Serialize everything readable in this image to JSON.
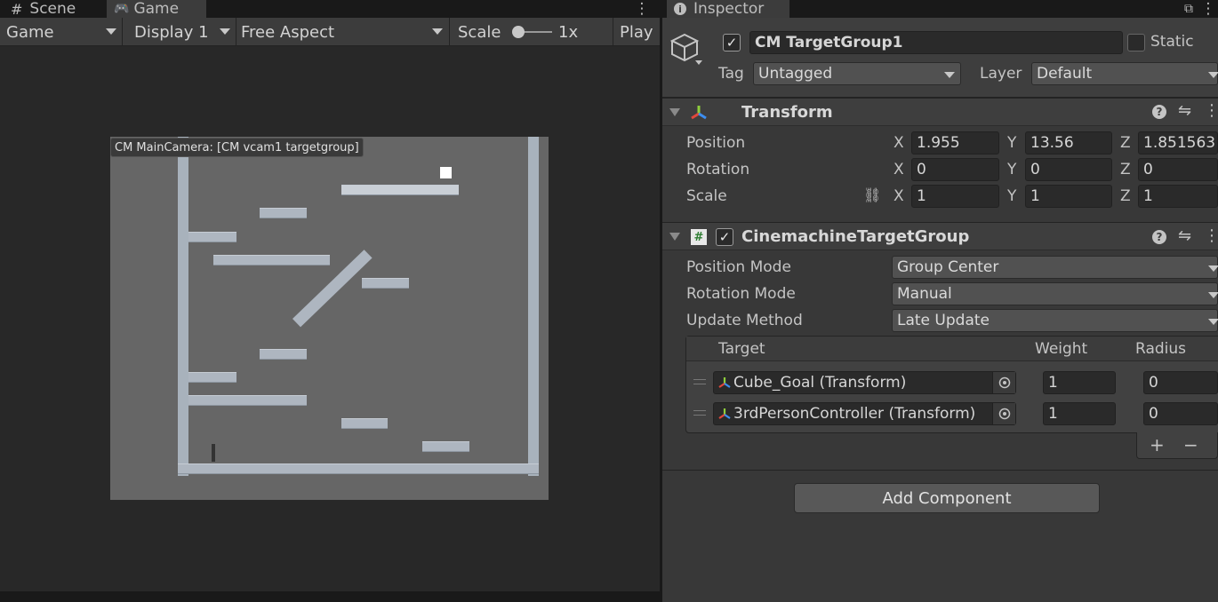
{
  "left_tabs": {
    "scene": "Scene",
    "game": "Game"
  },
  "game_toolbar": {
    "display_mode": "Game",
    "display": "Display 1",
    "aspect": "Free Aspect",
    "scale_label": "Scale",
    "scale_value": "1x",
    "play": "Play"
  },
  "game_view": {
    "camera_label": "CM MainCamera: [CM vcam1 targetgroup]"
  },
  "inspector": {
    "tab": "Inspector",
    "object_name": "CM TargetGroup1",
    "static_label": "Static",
    "tag_label": "Tag",
    "tag_value": "Untagged",
    "layer_label": "Layer",
    "layer_value": "Default",
    "transform": {
      "title": "Transform",
      "position_label": "Position",
      "rotation_label": "Rotation",
      "scale_label": "Scale",
      "axes": {
        "x": "X",
        "y": "Y",
        "z": "Z"
      },
      "position": {
        "x": "1.955",
        "y": "13.56",
        "z": "1.851563"
      },
      "rotation": {
        "x": "0",
        "y": "0",
        "z": "0"
      },
      "scale": {
        "x": "1",
        "y": "1",
        "z": "1"
      }
    },
    "target_group": {
      "title": "CinemachineTargetGroup",
      "position_mode_label": "Position Mode",
      "position_mode_value": "Group Center",
      "rotation_mode_label": "Rotation Mode",
      "rotation_mode_value": "Manual",
      "update_method_label": "Update Method",
      "update_method_value": "Late Update",
      "columns": {
        "target": "Target",
        "weight": "Weight",
        "radius": "Radius"
      },
      "targets": [
        {
          "name": "Cube_Goal (Transform)",
          "weight": "1",
          "radius": "0"
        },
        {
          "name": "3rdPersonController (Transform)",
          "weight": "1",
          "radius": "0"
        }
      ],
      "plus": "+",
      "minus": "−"
    },
    "add_component": "Add Component"
  },
  "colors": {
    "accent_x": "#e0483c",
    "accent_y": "#8fcf3c",
    "accent_z": "#3d8ef0"
  }
}
